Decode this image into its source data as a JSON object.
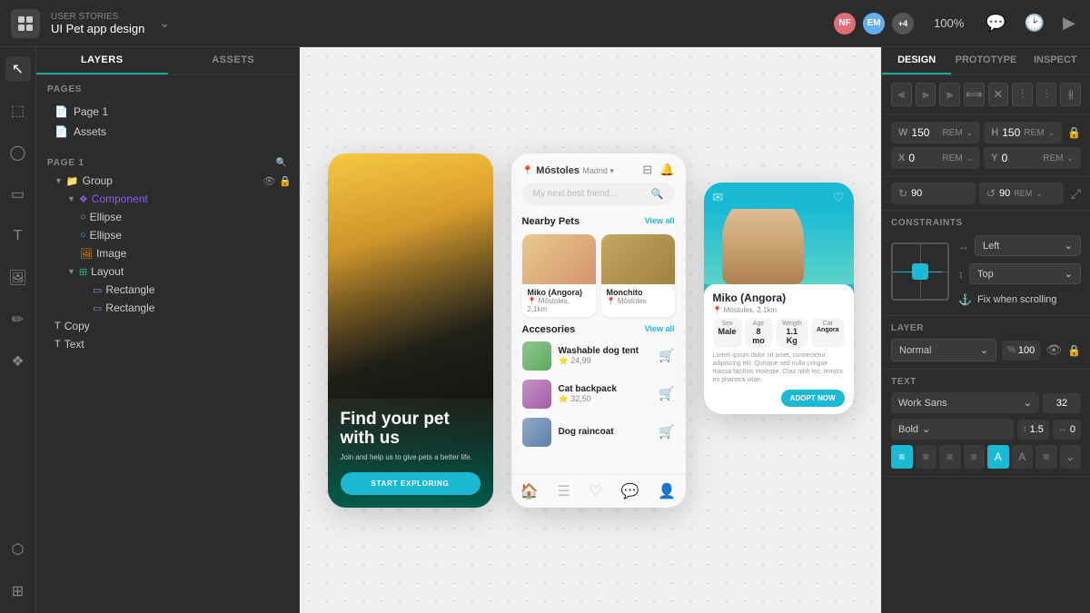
{
  "app": {
    "story_label": "USER STORIES",
    "project_name": "UI Pet app design"
  },
  "topbar": {
    "zoom": "100%",
    "avatar1_initials": "NF",
    "avatar2_initials": "EM",
    "avatar_more": "+4"
  },
  "left_panel": {
    "tab_layers": "LAYERS",
    "tab_assets": "ASSETS",
    "pages_label": "PAGES",
    "page1": "Page 1",
    "assets": "Assets",
    "page1_label": "PAGE 1"
  },
  "layers": [
    {
      "id": "group",
      "label": "Group",
      "type": "group",
      "indent": 0,
      "has_chevron": true,
      "expanded": true
    },
    {
      "id": "component",
      "label": "Component",
      "type": "component",
      "indent": 1,
      "has_chevron": true,
      "expanded": true
    },
    {
      "id": "ellipse1",
      "label": "Ellipse",
      "type": "ellipse",
      "indent": 2
    },
    {
      "id": "ellipse2",
      "label": "Ellipse",
      "type": "ellipse",
      "indent": 2
    },
    {
      "id": "image",
      "label": "Image",
      "type": "image",
      "indent": 2
    },
    {
      "id": "layout",
      "label": "Layout",
      "type": "layout",
      "indent": 1,
      "has_chevron": true,
      "expanded": true
    },
    {
      "id": "rect1",
      "label": "Rectangle",
      "type": "rect",
      "indent": 2
    },
    {
      "id": "rect2",
      "label": "Rectangle",
      "type": "rect",
      "indent": 2
    },
    {
      "id": "copy",
      "label": "Copy",
      "type": "text",
      "indent": 0
    },
    {
      "id": "text",
      "label": "Text",
      "type": "text",
      "indent": 0
    }
  ],
  "canvas": {
    "phone1": {
      "headline": "Find your pet with us",
      "sub": "Join and help us to give pets a better life.",
      "btn": "START EXPLORING"
    },
    "phone2": {
      "location": "Móstoles",
      "location_sub": "Madrid ▾",
      "search_placeholder": "My next best friend...",
      "nearby_title": "Nearby Pets",
      "view_all": "View all",
      "pet1_name": "Miko (Angora)",
      "pet1_loc": "Móstoles, 2,1km",
      "pet2_name": "Monchito",
      "pet2_loc": "Móstoles",
      "acc_title": "Accesories",
      "acc_view_all": "View all",
      "acc1_name": "Washable dog tent",
      "acc1_price": "24,99",
      "acc2_name": "Cat backpack",
      "acc2_price": "32,50",
      "acc3_name": "Dog raincoat"
    },
    "phone3": {
      "name": "Miko (Angora)",
      "loc": "Móstoles, 2,1km",
      "desc": "Lorem ipsum dolor sit amet, consectetur adipiscing elit. Quisque sed nulla congue massa facilisis molestie. Cras nibh leo, tempor en pharetra vitae.",
      "stat1_label": "Sex",
      "stat1_val": "Male",
      "stat2_label": "Age",
      "stat2_val": "8 mo",
      "stat3_label": "Weigth",
      "stat3_val": "1.1 Kg",
      "stat4_label": "Cat",
      "stat4_val": "Angora",
      "btn": "ADOPT NOW"
    }
  },
  "right_panel": {
    "tab_design": "DESIGN",
    "tab_prototype": "PROTOTYPE",
    "tab_inspect": "INSPECT"
  },
  "dimensions": {
    "w_label": "W",
    "w_value": "150",
    "w_unit": "REM",
    "h_label": "H",
    "h_value": "150",
    "h_unit": "REM",
    "x_label": "X",
    "x_value": "0",
    "x_unit": "REM",
    "y_label": "Y",
    "y_value": "0",
    "y_unit": "REM",
    "rotate_value": "90",
    "rotate2_value": "90",
    "rotate2_unit": "REM"
  },
  "constraints": {
    "label": "CONSTRAINTS",
    "horizontal_label": "Left",
    "vertical_label": "Top",
    "fix_scroll_label": "Fix when scrolling"
  },
  "layer_section": {
    "label": "LAYER",
    "blend_mode": "Normal",
    "opacity": "100",
    "opacity_symbol": "%"
  },
  "text_section": {
    "label": "TEXT",
    "font_family": "Work Sans",
    "font_size": "32",
    "font_style": "Bold",
    "line_height": "1.5",
    "letter_spacing": "0"
  }
}
